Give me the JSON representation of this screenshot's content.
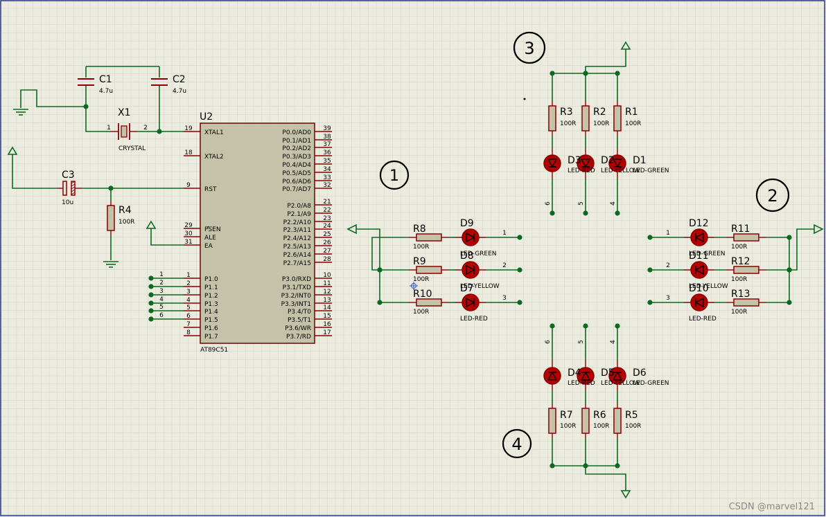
{
  "colors": {
    "grid": "#d7d7cb",
    "background": "#ebebdf",
    "wire": "#0b6a1f",
    "component": "#8b0000",
    "body_fill": "#c4c2a8",
    "led_fill": "#b30000",
    "ic_outline": "#7a1010"
  },
  "mcu": {
    "ref": "U2",
    "part": "AT89C51",
    "left_pins": [
      {
        "num": "19",
        "name": "XTAL1"
      },
      {
        "num": "18",
        "name": "XTAL2"
      },
      {
        "num": "9",
        "name": "RST"
      },
      {
        "num": "29",
        "name": "PSEN"
      },
      {
        "num": "30",
        "name": "ALE"
      },
      {
        "num": "31",
        "name": "EA"
      },
      {
        "num": "1",
        "name": "P1.0"
      },
      {
        "num": "2",
        "name": "P1.1"
      },
      {
        "num": "3",
        "name": "P1.2"
      },
      {
        "num": "4",
        "name": "P1.3"
      },
      {
        "num": "5",
        "name": "P1.4"
      },
      {
        "num": "6",
        "name": "P1.5"
      },
      {
        "num": "7",
        "name": "P1.6"
      },
      {
        "num": "8",
        "name": "P1.7"
      }
    ],
    "right_pins": [
      {
        "num": "39",
        "name": "P0.0/AD0"
      },
      {
        "num": "38",
        "name": "P0.1/AD1"
      },
      {
        "num": "37",
        "name": "P0.2/AD2"
      },
      {
        "num": "36",
        "name": "P0.3/AD3"
      },
      {
        "num": "35",
        "name": "P0.4/AD4"
      },
      {
        "num": "34",
        "name": "P0.5/AD5"
      },
      {
        "num": "33",
        "name": "P0.6/AD6"
      },
      {
        "num": "32",
        "name": "P0.7/AD7"
      },
      {
        "num": "21",
        "name": "P2.0/A8"
      },
      {
        "num": "22",
        "name": "P2.1/A9"
      },
      {
        "num": "23",
        "name": "P2.2/A10"
      },
      {
        "num": "24",
        "name": "P2.3/A11"
      },
      {
        "num": "25",
        "name": "P2.4/A12"
      },
      {
        "num": "26",
        "name": "P2.5/A13"
      },
      {
        "num": "27",
        "name": "P2.6/A14"
      },
      {
        "num": "28",
        "name": "P2.7/A15"
      },
      {
        "num": "10",
        "name": "P3.0/RXD"
      },
      {
        "num": "11",
        "name": "P3.1/TXD"
      },
      {
        "num": "12",
        "name": "P3.2/INT0"
      },
      {
        "num": "13",
        "name": "P3.3/INT1"
      },
      {
        "num": "14",
        "name": "P3.4/T0"
      },
      {
        "num": "15",
        "name": "P3.5/T1"
      },
      {
        "num": "16",
        "name": "P3.6/WR"
      },
      {
        "num": "17",
        "name": "P3.7/RD"
      }
    ],
    "p1_net_labels": [
      "1",
      "2",
      "3",
      "4",
      "5",
      "6"
    ]
  },
  "components": {
    "C1": {
      "ref": "C1",
      "value": "4.7u"
    },
    "C2": {
      "ref": "C2",
      "value": "4.7u"
    },
    "X1": {
      "ref": "X1",
      "value": "CRYSTAL",
      "pin1": "1",
      "pin2": "2"
    },
    "C3": {
      "ref": "C3",
      "value": "10u"
    },
    "R4": {
      "ref": "R4",
      "value": "100R"
    }
  },
  "groups": {
    "g1": {
      "marker": "1",
      "rows": [
        {
          "res": "R8",
          "rval": "100R",
          "led": "D9",
          "ltype": "LED-GREEN",
          "net": "1"
        },
        {
          "res": "R9",
          "rval": "100R",
          "led": "D8",
          "ltype": "LED-YELLOW",
          "net": "2"
        },
        {
          "res": "R10",
          "rval": "100R",
          "led": "D7",
          "ltype": "LED-RED",
          "net": "3"
        }
      ]
    },
    "g2": {
      "marker": "2",
      "rows": [
        {
          "res": "R11",
          "rval": "100R",
          "led": "D12",
          "ltype": "LED-GREEN",
          "net": "1"
        },
        {
          "res": "R12",
          "rval": "100R",
          "led": "D11",
          "ltype": "LED-YELLOW",
          "net": "2"
        },
        {
          "res": "R13",
          "rval": "100R",
          "led": "D10",
          "ltype": "LED-RED",
          "net": "3"
        }
      ]
    },
    "g3": {
      "marker": "3",
      "cols": [
        {
          "res": "R3",
          "rval": "100R",
          "led": "D3",
          "ltype": "LED-RED",
          "net": "6"
        },
        {
          "res": "R2",
          "rval": "100R",
          "led": "D2",
          "ltype": "LED-YELLOW",
          "net": "5"
        },
        {
          "res": "R1",
          "rval": "100R",
          "led": "D1",
          "ltype": "LED-GREEN",
          "net": "4"
        }
      ]
    },
    "g4": {
      "marker": "4",
      "cols": [
        {
          "res": "R7",
          "rval": "100R",
          "led": "D4",
          "ltype": "LED-RED",
          "net": "6"
        },
        {
          "res": "R6",
          "rval": "100R",
          "led": "D5",
          "ltype": "LED-YELLOW",
          "net": "5"
        },
        {
          "res": "R5",
          "rval": "100R",
          "led": "D6",
          "ltype": "LED-GREEN",
          "net": "4"
        }
      ]
    }
  },
  "watermark": "CSDN @marvel121"
}
